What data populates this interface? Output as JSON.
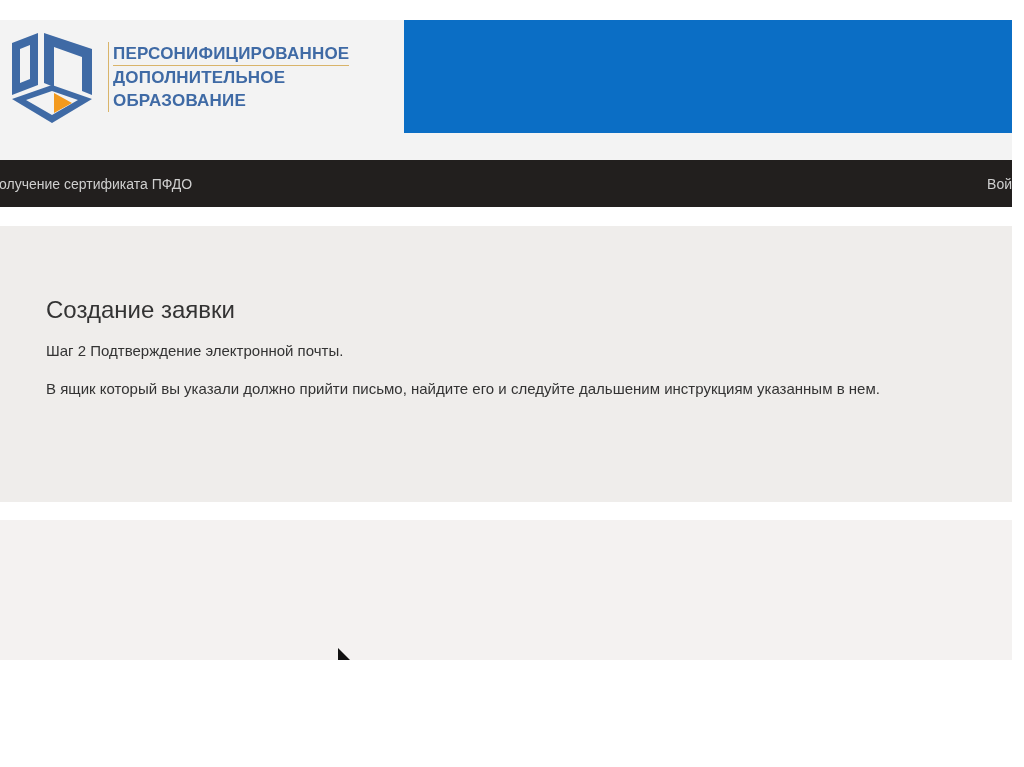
{
  "header": {
    "logo_text": [
      "ПЕРСОНИФИЦИРОВАННОЕ",
      "ДОПОЛНИТЕЛЬНОЕ",
      "ОБРАЗОВАНИЕ"
    ]
  },
  "navbar": {
    "left_link": "олучение сертификата ПФДО",
    "right_link": "Вой"
  },
  "card": {
    "title": "Создание заявки",
    "step": "Шаг 2 Подтверждение электронной почты.",
    "message": "В ящик который вы указали должно прийти письмо, найдите его и следуйте дальшеним инструкциям указанным в нем."
  }
}
